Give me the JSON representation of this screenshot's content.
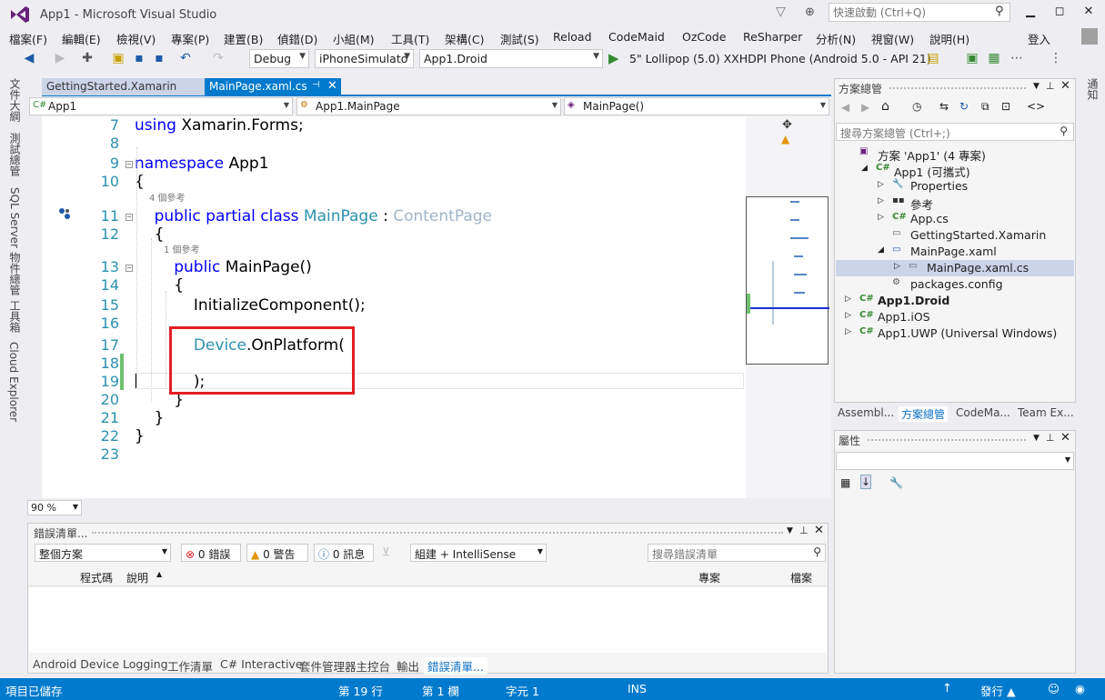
{
  "window": {
    "title": "App1 - Microsoft Visual Studio",
    "quick_launch_placeholder": "快速啟動 (Ctrl+Q)",
    "sign_in": "登入"
  },
  "menu": [
    "檔案(F)",
    "編輯(E)",
    "檢視(V)",
    "專案(P)",
    "建置(B)",
    "偵錯(D)",
    "小組(M)",
    "工具(T)",
    "架構(C)",
    "測試(S)",
    "Reload",
    "CodeMaid",
    "OzCode",
    "ReSharper",
    "分析(N)",
    "視窗(W)",
    "說明(H)"
  ],
  "toolbar": {
    "config": "Debug",
    "platform": "iPhoneSimulato",
    "startup_project": "App1.Droid",
    "run_target": "5\" Lollipop (5.0) XXHDPI Phone (Android 5.0 - API 21)"
  },
  "left_tabs": [
    "文件大綱",
    "測試總管",
    "SQL Server 物件總管",
    "工具箱",
    "Cloud Explorer"
  ],
  "doc_tabs": [
    {
      "label": "GettingStarted.Xamarin"
    },
    {
      "label": "MainPage.xaml.cs"
    }
  ],
  "nav": {
    "project": "App1",
    "type": "App1.MainPage",
    "member": "MainPage()"
  },
  "code": {
    "lines": [
      {
        "n": "7",
        "tokens": [
          {
            "t": "using",
            "c": "kw"
          },
          {
            "t": " Xamarin.Forms;",
            "c": ""
          }
        ]
      },
      {
        "n": "8",
        "tokens": []
      },
      {
        "n": "9",
        "tokens": [
          {
            "t": "namespace",
            "c": "kw"
          },
          {
            "t": " App1",
            "c": ""
          }
        ]
      },
      {
        "n": "10",
        "tokens": [
          {
            "t": "{",
            "c": ""
          }
        ]
      },
      {
        "n": "11",
        "tokens": [
          {
            "t": "    public partial class",
            "c": "kw"
          },
          {
            "t": " MainPage",
            "c": "ty"
          },
          {
            "t": " : ",
            "c": ""
          },
          {
            "t": "ContentPage",
            "c": "ty2"
          }
        ]
      },
      {
        "n": "12",
        "tokens": [
          {
            "t": "    {",
            "c": ""
          }
        ]
      },
      {
        "n": "13",
        "tokens": [
          {
            "t": "        public",
            "c": "kw"
          },
          {
            "t": " MainPage()",
            "c": ""
          }
        ]
      },
      {
        "n": "14",
        "tokens": [
          {
            "t": "        {",
            "c": ""
          }
        ]
      },
      {
        "n": "15",
        "tokens": [
          {
            "t": "            InitializeComponent();",
            "c": ""
          }
        ]
      },
      {
        "n": "16",
        "tokens": []
      },
      {
        "n": "17",
        "tokens": [
          {
            "t": "            Device",
            "c": "ty"
          },
          {
            "t": ".OnPlatform(",
            "c": ""
          }
        ]
      },
      {
        "n": "18",
        "tokens": []
      },
      {
        "n": "19",
        "tokens": [
          {
            "t": "            );",
            "c": ""
          }
        ]
      },
      {
        "n": "20",
        "tokens": [
          {
            "t": "        }",
            "c": ""
          }
        ]
      },
      {
        "n": "21",
        "tokens": [
          {
            "t": "    }",
            "c": ""
          }
        ]
      },
      {
        "n": "22",
        "tokens": [
          {
            "t": "}",
            "c": ""
          }
        ]
      },
      {
        "n": "23",
        "tokens": []
      }
    ],
    "ref_class": "4 個參考",
    "ref_ctor": "1 個參考"
  },
  "zoom": "90 %",
  "solution_explorer": {
    "title": "方案總管",
    "search_placeholder": "搜尋方案總管 (Ctrl+;)",
    "items": [
      {
        "label": "方案 'App1' (4 專案)",
        "icon": "sln",
        "bold": false
      },
      {
        "label": "App1 (可攜式)",
        "icon": "C#",
        "bold": false
      },
      {
        "label": "Properties",
        "icon": "wrench",
        "bold": false
      },
      {
        "label": "參考",
        "icon": "ref",
        "bold": false
      },
      {
        "label": "App.cs",
        "icon": "C#",
        "bold": false
      },
      {
        "label": "GettingStarted.Xamarin",
        "icon": "file",
        "bold": false
      },
      {
        "label": "MainPage.xaml",
        "icon": "xaml",
        "bold": false
      },
      {
        "label": "MainPage.xaml.cs",
        "icon": "file",
        "bold": false
      },
      {
        "label": "packages.config",
        "icon": "cfg",
        "bold": false
      },
      {
        "label": "App1.Droid",
        "icon": "C#",
        "bold": true
      },
      {
        "label": "App1.iOS",
        "icon": "C#",
        "bold": false
      },
      {
        "label": "App1.UWP (Universal Windows)",
        "icon": "C#",
        "bold": false
      }
    ],
    "tabs": [
      "Assembl...",
      "方案總管",
      "CodeMa...",
      "Team Ex..."
    ]
  },
  "properties": {
    "title": "屬性"
  },
  "right_strip": "通知",
  "error_list": {
    "title": "錯誤清單...",
    "scope": "整個方案",
    "errors": "0 錯誤",
    "warnings": "0 警告",
    "messages": "0 訊息",
    "build_filter": "組建 + IntelliSense",
    "search_placeholder": "搜尋錯誤清單",
    "col_code": "程式碼",
    "col_desc": "說明",
    "col_project": "專案",
    "col_file": "檔案"
  },
  "bottom_tabs": [
    "Android Device Logging",
    "工作清單",
    "C# Interactive",
    "套件管理器主控台",
    "輸出",
    "錯誤清單..."
  ],
  "status": {
    "left": "項目已儲存",
    "line": "第 19 行",
    "col": "第 1 欄",
    "char": "字元 1",
    "mode": "INS",
    "publish": "發行 ▲"
  },
  "colors": {
    "accent": "#007acc",
    "highlight": "#e51c24",
    "keyword": "#0000ff",
    "type": "#2b91af"
  }
}
